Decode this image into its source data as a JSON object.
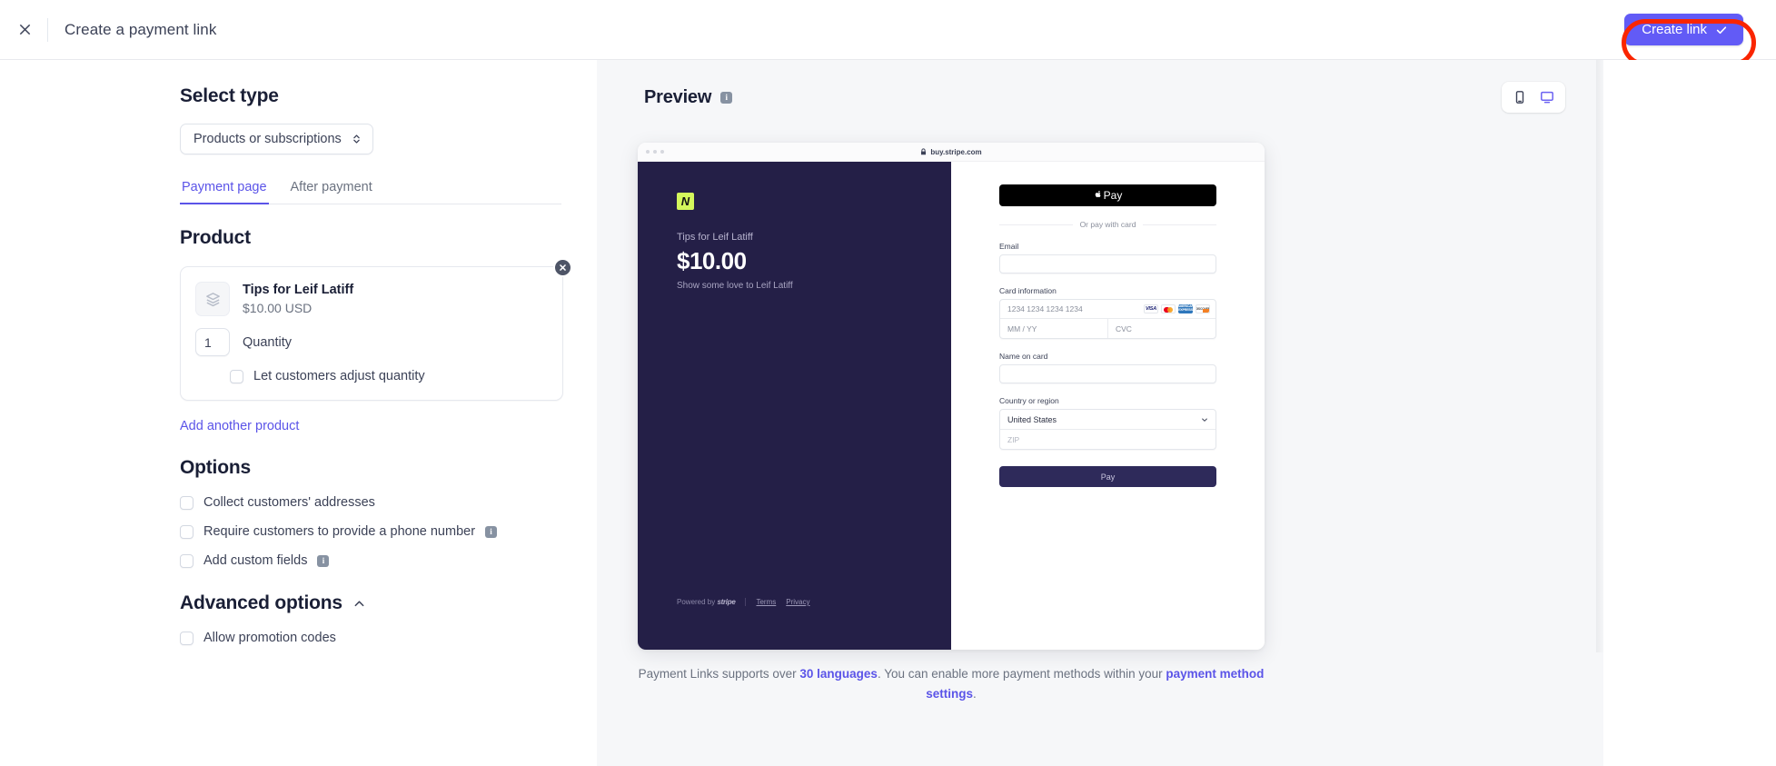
{
  "topbar": {
    "close_icon": "close-icon",
    "title": "Create a payment link",
    "create_button": "Create link",
    "create_button_icon": "check-icon",
    "accent_color": "#625bf6",
    "annotation_color": "#fa2500"
  },
  "left": {
    "select_type_heading": "Select type",
    "type_select_value": "Products or subscriptions",
    "tabs": [
      {
        "label": "Payment page",
        "active": true
      },
      {
        "label": "After payment",
        "active": false
      }
    ],
    "product_heading": "Product",
    "product": {
      "name": "Tips for Leif Latiff",
      "price": "$10.00 USD",
      "quantity": "1",
      "quantity_label": "Quantity",
      "adjust_label": "Let customers adjust quantity",
      "adjust_checked": false,
      "remove_icon": "close-circle-icon",
      "thumb_icon": "box-icon"
    },
    "add_product_link": "Add another product",
    "options_heading": "Options",
    "options": [
      {
        "label": "Collect customers' addresses",
        "checked": false,
        "info": false
      },
      {
        "label": "Require customers to provide a phone number",
        "checked": false,
        "info": true
      },
      {
        "label": "Add custom fields",
        "checked": false,
        "info": true
      }
    ],
    "advanced_heading": "Advanced options",
    "advanced_chevron": "chevron-up-icon",
    "advanced_options": [
      {
        "label": "Allow promotion codes",
        "checked": false
      }
    ]
  },
  "preview": {
    "title": "Preview",
    "title_info_icon": "info-icon",
    "devices": [
      {
        "name": "mobile-icon",
        "active": false
      },
      {
        "name": "desktop-icon",
        "active": true
      }
    ],
    "browser": {
      "url": "buy.stripe.com",
      "lock_icon": "lock-icon"
    },
    "checkout": {
      "merchant_logo_letter": "N",
      "merchant_logo_color": "#d4f75c",
      "panel_color": "#241f47",
      "product_name": "Tips for Leif Latiff",
      "amount": "$10.00",
      "description": "Show some love to Leif Latiff",
      "powered_by_prefix": "Powered by",
      "powered_by_brand": "stripe",
      "footer_links": [
        "Terms",
        "Privacy"
      ],
      "apple_pay_label": "Pay",
      "apple_pay_icon": "apple-icon",
      "or_divider": "Or pay with card",
      "email_label": "Email",
      "email_value": "",
      "card_info_label": "Card information",
      "card_number_placeholder": "1234 1234 1234 1234",
      "card_brands": [
        "VISA",
        "Mastercard",
        "AMEX",
        "Discover"
      ],
      "expiry_placeholder": "MM / YY",
      "cvc_placeholder": "CVC",
      "name_label": "Name on card",
      "name_value": "",
      "country_label": "Country or region",
      "country_value": "United States",
      "country_chevron": "chevron-down-icon",
      "zip_placeholder": "ZIP",
      "pay_button": "Pay"
    },
    "footnote": {
      "part1": "Payment Links supports over ",
      "link1": "30 languages",
      "part2": ". You can enable more payment methods within your ",
      "link2": "payment method settings",
      "part3": "."
    }
  }
}
